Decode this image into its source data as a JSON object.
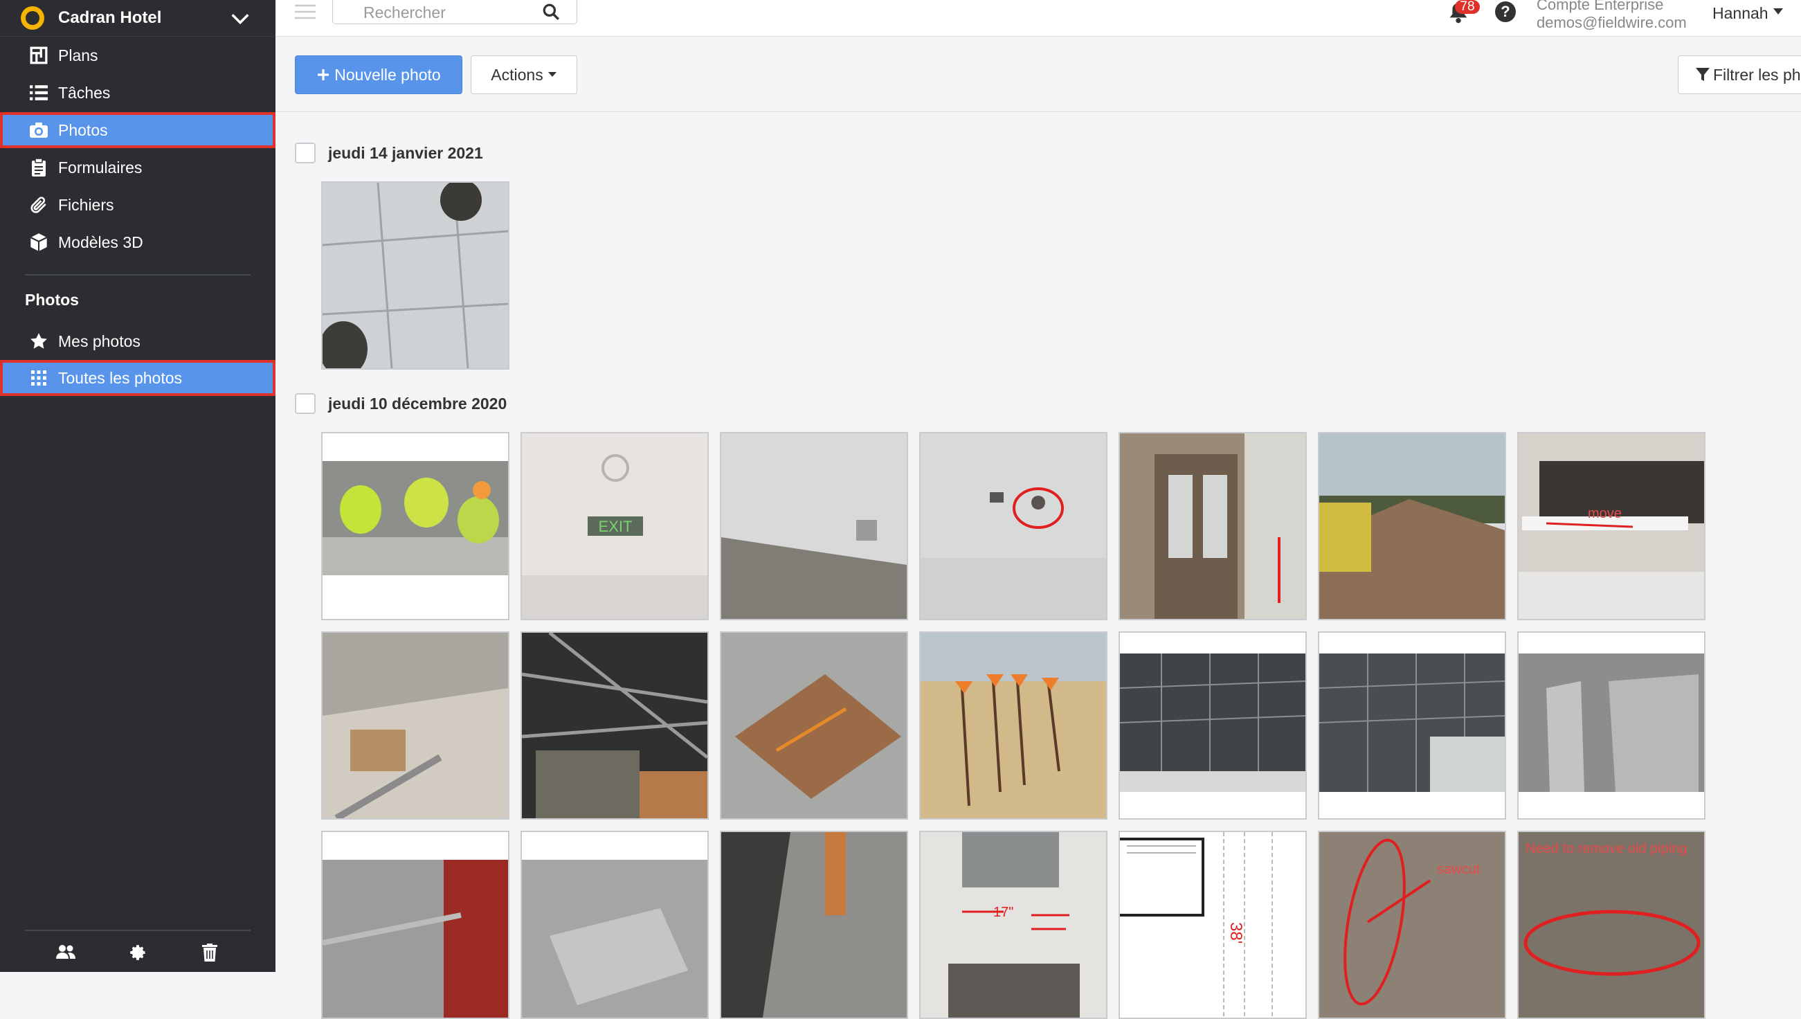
{
  "sidebar": {
    "project": "Cadran Hotel",
    "nav": [
      {
        "label": "Plans",
        "icon": "plans-icon"
      },
      {
        "label": "Tâches",
        "icon": "list-icon"
      },
      {
        "label": "Photos",
        "icon": "camera-icon"
      },
      {
        "label": "Formulaires",
        "icon": "clipboard-icon"
      },
      {
        "label": "Fichiers",
        "icon": "paperclip-icon"
      },
      {
        "label": "Modèles 3D",
        "icon": "cube-icon"
      }
    ],
    "section_title": "Photos",
    "sub": [
      {
        "label": "Mes photos",
        "icon": "star-icon"
      },
      {
        "label": "Toutes les photos",
        "icon": "grid-icon"
      }
    ],
    "bottom_icons": [
      "users-icon",
      "gear-icon",
      "trash-icon"
    ]
  },
  "topbar": {
    "search_placeholder": "Rechercher",
    "notifications": "78",
    "help": "?",
    "account_type": "Compte Enterprise",
    "account_email": "demos@fieldwire.com",
    "user": "Hannah"
  },
  "toolbar": {
    "new_photo": "Nouvelle photo",
    "actions": "Actions",
    "filter": "Filtrer les ph"
  },
  "groups": [
    {
      "date": "jeudi 14 janvier 2021",
      "count": 1
    },
    {
      "date": "jeudi 10 décembre 2020",
      "count": 21
    }
  ],
  "annotations": {
    "move": "move",
    "exit": "EXIT",
    "seventeen": "17\"",
    "thirtyeight": "38'",
    "sawcut": "sawcut",
    "remove": "Need to remove old piping"
  }
}
